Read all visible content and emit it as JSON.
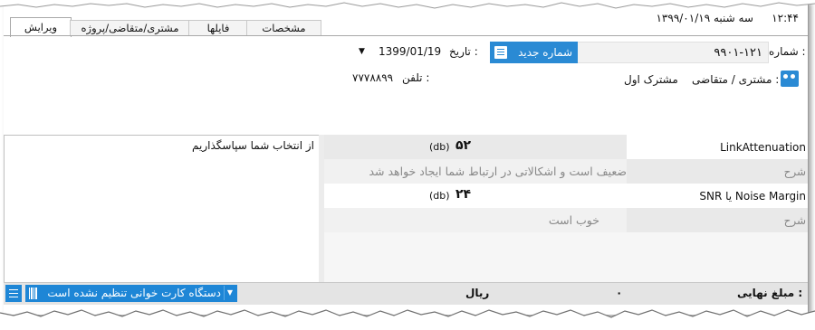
{
  "header": {
    "time": "۱۲:۴۴",
    "date_text": "سه شنبه ۱۳۹۹/۰۱/۱۹"
  },
  "tabs": [
    {
      "label": "ویرایش"
    },
    {
      "label": "مشتری/متقاضی/پروژه"
    },
    {
      "label": "فایلها"
    },
    {
      "label": "مشخصات"
    }
  ],
  "form": {
    "number_label": "شماره :",
    "number_value": "۹۹۰۱-۱۲۱",
    "new_number_button": "شماره جدید",
    "date_label": "تاریخ :",
    "date_value": "1399/01/19",
    "customer_label": "مشتری / متقاضی :",
    "customer_value": "مشترک اول",
    "phone_label": "تلفن :",
    "phone_value": "۷۷۷۸۸۹۹"
  },
  "notes": {
    "text": "از انتخاب شما سپاسگذاریم"
  },
  "results": [
    {
      "name": "LinkAttenuation",
      "value": "۵۲",
      "unit": "(db)",
      "desc_label": "شرح",
      "desc": "ضعیف است و اشکالاتی در ارتباط شما ایجاد خواهد شد"
    },
    {
      "name": "SNR یا Noise Margin",
      "value": "۲۴",
      "unit": "(db)",
      "desc_label": "شرح",
      "desc": "خوب است"
    }
  ],
  "status": {
    "final_amount_label": "مبلغ نهایی :",
    "final_amount_value": "۰",
    "currency": "ریال",
    "card_reader": "دستگاه کارت خوانی تنظیم نشده است"
  },
  "colors": {
    "accent": "#2a8ad4",
    "gray_cell": "#e9e9e9"
  }
}
